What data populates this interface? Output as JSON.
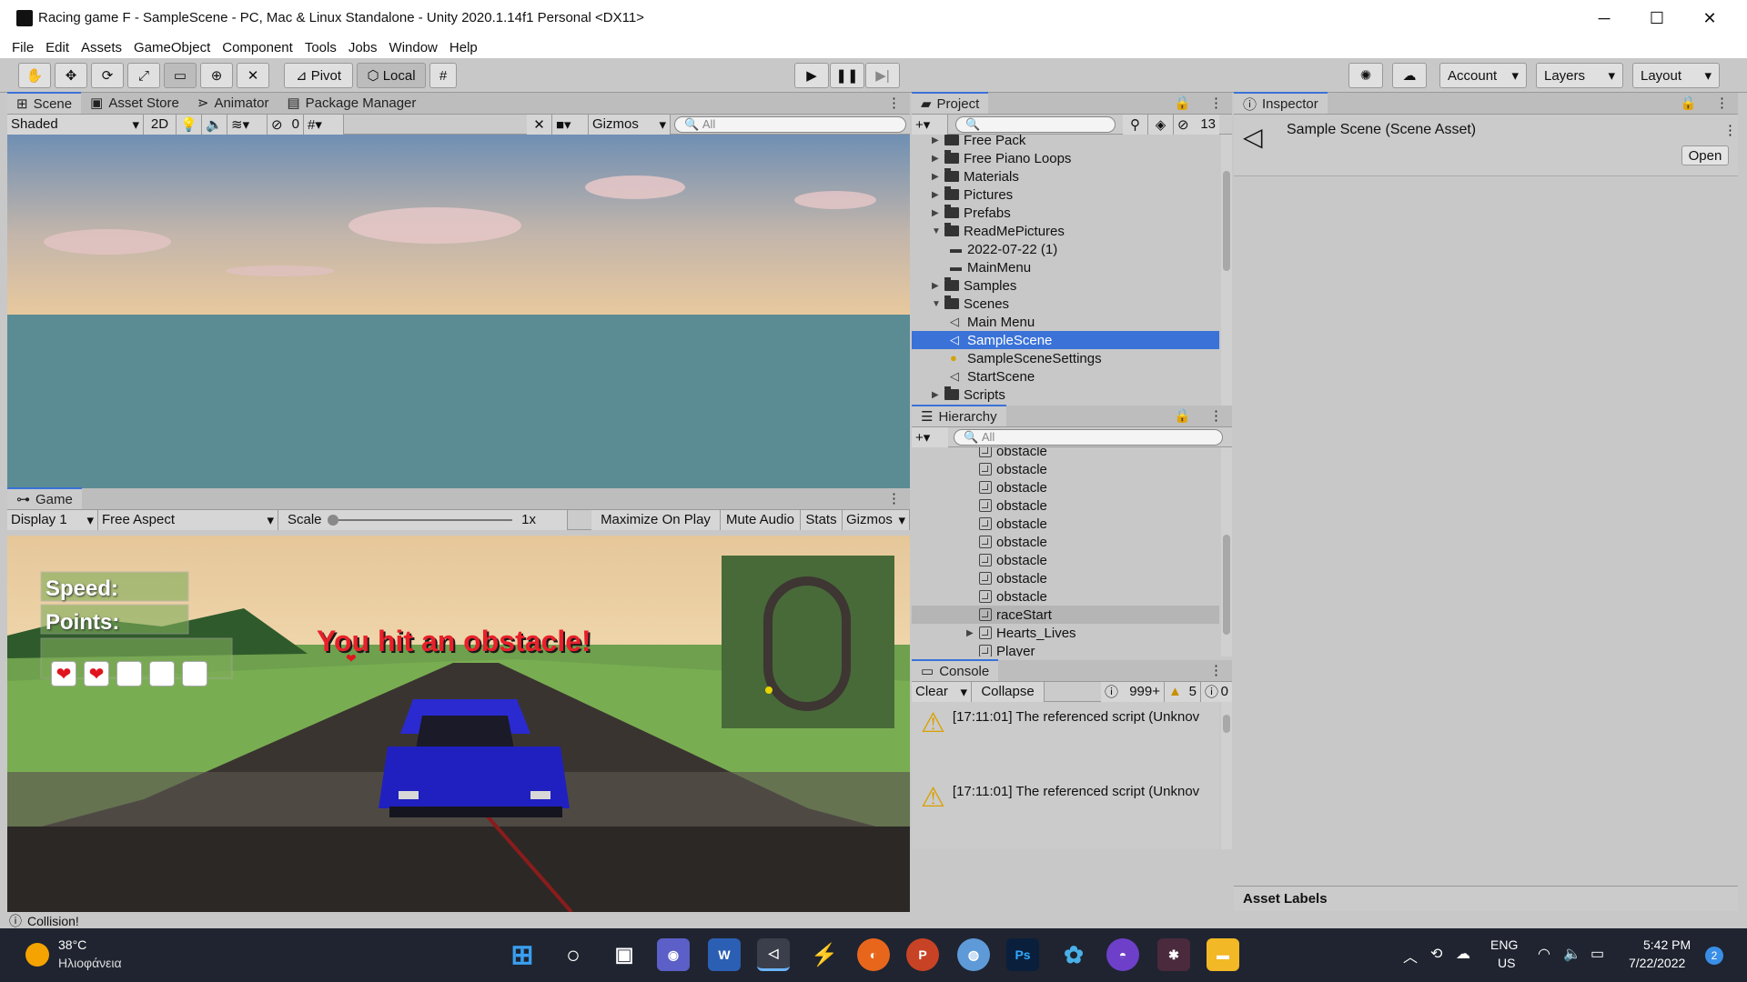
{
  "window": {
    "title": "Racing game F - SampleScene - PC, Mac & Linux Standalone - Unity 2020.1.14f1 Personal <DX11>",
    "minimize": "─",
    "maximize": "☐",
    "close": "✕"
  },
  "menu": [
    "File",
    "Edit",
    "Assets",
    "GameObject",
    "Component",
    "Tools",
    "Jobs",
    "Window",
    "Help"
  ],
  "toolbar": {
    "pivot": "Pivot",
    "local": "Local",
    "account": "Account",
    "layers": "Layers",
    "layout": "Layout"
  },
  "scene": {
    "tabs": [
      "Scene",
      "Asset Store",
      "Animator",
      "Package Manager"
    ],
    "shading": "Shaded",
    "mode2d": "2D",
    "hidden_count": "0",
    "gizmos": "Gizmos",
    "search_placeholder": "All"
  },
  "game": {
    "tab": "Game",
    "display": "Display 1",
    "aspect": "Free Aspect",
    "scale_label": "Scale",
    "scale_value": "1x",
    "buttons": [
      "Maximize On Play",
      "Mute Audio",
      "Stats",
      "Gizmos"
    ],
    "hud": {
      "speed": "Speed:",
      "points": "Points:",
      "message": "You hit an obstacle!",
      "hearts_filled": 2,
      "hearts_total": 5
    }
  },
  "project": {
    "tab": "Project",
    "hidden_count": "13",
    "items": [
      {
        "label": "Free Pack",
        "depth": 0,
        "type": "folder",
        "expand": "right"
      },
      {
        "label": "Free Piano Loops",
        "depth": 0,
        "type": "folder",
        "expand": "right"
      },
      {
        "label": "Materials",
        "depth": 0,
        "type": "folder",
        "expand": "right"
      },
      {
        "label": "Pictures",
        "depth": 0,
        "type": "folder",
        "expand": "right"
      },
      {
        "label": "Prefabs",
        "depth": 0,
        "type": "folder",
        "expand": "right"
      },
      {
        "label": "ReadMePictures",
        "depth": 0,
        "type": "folder",
        "expand": "down"
      },
      {
        "label": "2022-07-22 (1)",
        "depth": 1,
        "type": "file"
      },
      {
        "label": "MainMenu",
        "depth": 1,
        "type": "file"
      },
      {
        "label": "Samples",
        "depth": 0,
        "type": "folder",
        "expand": "right"
      },
      {
        "label": "Scenes",
        "depth": 0,
        "type": "folder",
        "expand": "down"
      },
      {
        "label": "Main Menu",
        "depth": 1,
        "type": "scene"
      },
      {
        "label": "SampleScene",
        "depth": 1,
        "type": "scene",
        "selected": true
      },
      {
        "label": "SampleSceneSettings",
        "depth": 1,
        "type": "settings"
      },
      {
        "label": "StartScene",
        "depth": 1,
        "type": "scene"
      },
      {
        "label": "Scripts",
        "depth": 0,
        "type": "folder",
        "expand": "right"
      }
    ]
  },
  "hierarchy": {
    "tab": "Hierarchy",
    "search_placeholder": "All",
    "items": [
      {
        "label": "obstacle"
      },
      {
        "label": "obstacle"
      },
      {
        "label": "obstacle"
      },
      {
        "label": "obstacle"
      },
      {
        "label": "obstacle"
      },
      {
        "label": "obstacle"
      },
      {
        "label": "obstacle"
      },
      {
        "label": "obstacle"
      },
      {
        "label": "obstacle"
      },
      {
        "label": "raceStart",
        "highlight": true
      },
      {
        "label": "Hearts_Lives",
        "expandable": true
      },
      {
        "label": "Player"
      }
    ]
  },
  "console": {
    "tab": "Console",
    "clear": "Clear",
    "collapse": "Collapse",
    "info_count": "999+",
    "warn_count": "5",
    "error_count": "0",
    "messages": [
      "[17:11:01] The referenced script (Unknov",
      "[17:11:01] The referenced script (Unknov"
    ]
  },
  "inspector": {
    "tab": "Inspector",
    "asset_title": "Sample Scene (Scene Asset)",
    "open": "Open",
    "asset_labels": "Asset Labels"
  },
  "status": {
    "text": "Collision!"
  },
  "taskbar": {
    "weather_temp": "38°C",
    "weather_desc": "Ηλιοφάνεια",
    "lang1": "ENG",
    "lang2": "US",
    "time": "5:42 PM",
    "date": "7/22/2022",
    "notif": "2"
  },
  "colors": {
    "accent": "#3a72d8",
    "selection": "#3a72d8",
    "hud_message": "#e8202a",
    "car": "#2020c0"
  }
}
